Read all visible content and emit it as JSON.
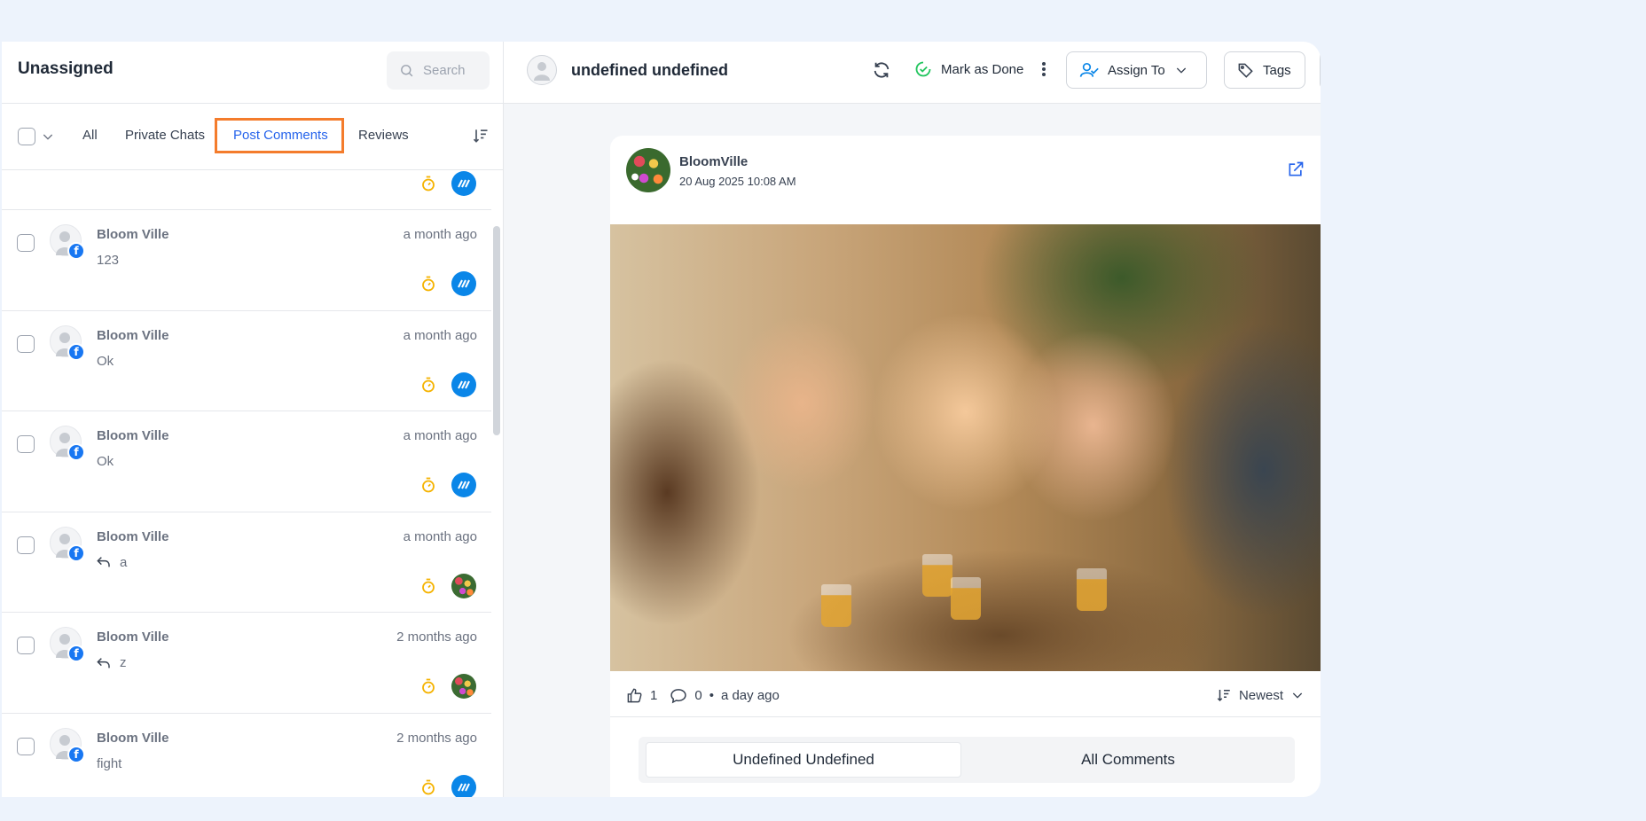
{
  "left": {
    "title": "Unassigned",
    "search_placeholder": "Search",
    "tabs": [
      "All",
      "Private Chats",
      "Post Comments",
      "Reviews"
    ],
    "active_tab": "Post Comments"
  },
  "conversations": [
    {
      "name": "Bloom Ville",
      "time": "a month ago",
      "message": "123",
      "reply": false,
      "badge": "brand"
    },
    {
      "name": "Bloom Ville",
      "time": "a month ago",
      "message": "Ok",
      "reply": false,
      "badge": "brand"
    },
    {
      "name": "Bloom Ville",
      "time": "a month ago",
      "message": "Ok",
      "reply": false,
      "badge": "brand"
    },
    {
      "name": "Bloom Ville",
      "time": "a month ago",
      "message": "a",
      "reply": true,
      "badge": "flower"
    },
    {
      "name": "Bloom Ville",
      "time": "2 months ago",
      "message": "z",
      "reply": true,
      "badge": "flower"
    },
    {
      "name": "Bloom Ville",
      "time": "2 months ago",
      "message": "fight",
      "reply": false,
      "badge": "brand"
    }
  ],
  "header": {
    "user_name": "undefined undefined",
    "mark_done": "Mark as Done",
    "assign_to": "Assign To",
    "tags": "Tags"
  },
  "post": {
    "page_name": "BloomVille",
    "date": "20 Aug 2025 10:08 AM",
    "likes": "1",
    "comments": "0",
    "separator": "•",
    "time_ago": "a day ago",
    "sort_label": "Newest",
    "toggle_selected": "Undefined Undefined",
    "toggle_other": "All Comments"
  },
  "colors": {
    "accent": "#2563eb",
    "highlight_box": "#f47c2c",
    "facebook": "#1877f2",
    "brand_badge": "#0a86e8",
    "timer": "#f5b301",
    "done_check": "#22c55e"
  }
}
